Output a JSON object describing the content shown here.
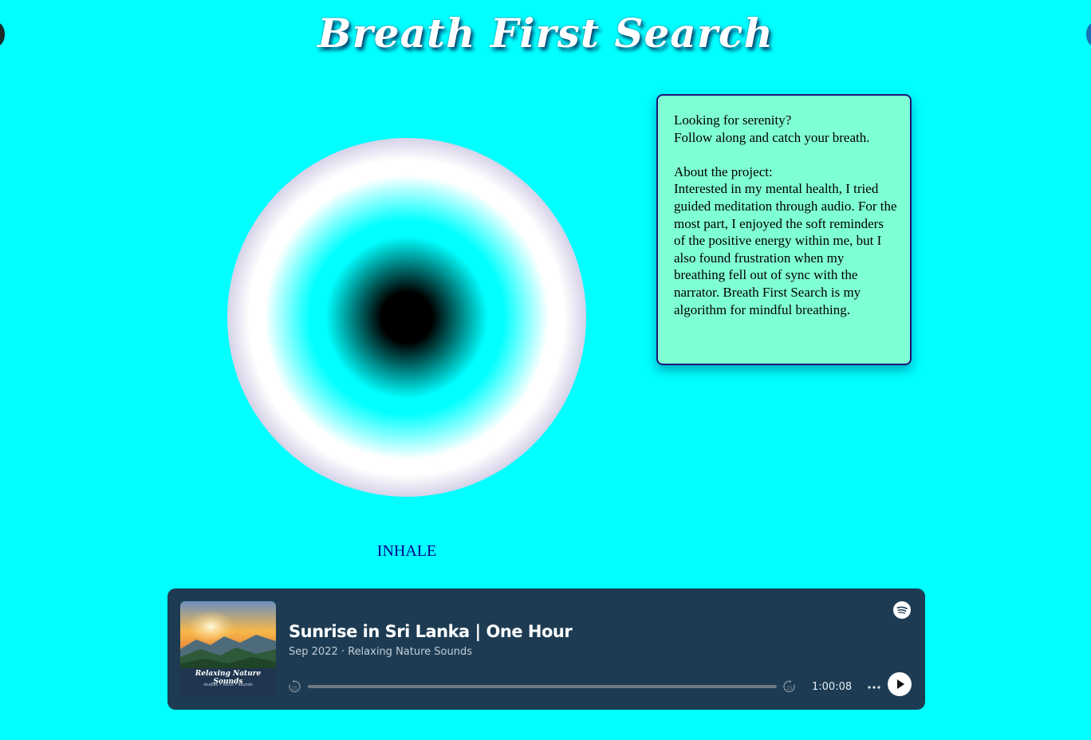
{
  "app": {
    "title": "Breath First Search"
  },
  "breathing": {
    "phase_label": "INHALE"
  },
  "info_card": {
    "intro_line1": "Looking for serenity?",
    "intro_line2": "Follow along and catch your breath.",
    "about_heading": "About the project:",
    "about_body": "Interested in my mental health, I tried guided meditation through audio. For the most part, I enjoyed the soft reminders of the positive energy within me, but I also found frustration when my breathing fell out of sync with the narrator. Breath First Search is my algorithm for mindful breathing."
  },
  "player": {
    "track_title": "Sunrise in Sri Lanka | One Hour",
    "track_meta": "Sep 2022 · Relaxing Nature Sounds",
    "duration": "1:00:08",
    "progress_fraction": 0,
    "cover_title": "Relaxing Nature Sounds",
    "cover_subtitle": "studies • focus • sounds",
    "colors": {
      "background": "#1d3c53",
      "accent": "#ffffff"
    },
    "icons": {
      "spotify": "spotify-logo-icon",
      "skip_back": "skip-back-15-icon",
      "skip_forward": "skip-forward-15-icon",
      "more": "more-options-icon",
      "play": "play-icon"
    }
  },
  "colors": {
    "page_background": "#00FFFF",
    "card_background": "#7FFFD4",
    "card_border": "#1c1678",
    "phase_label": "#00008B"
  }
}
